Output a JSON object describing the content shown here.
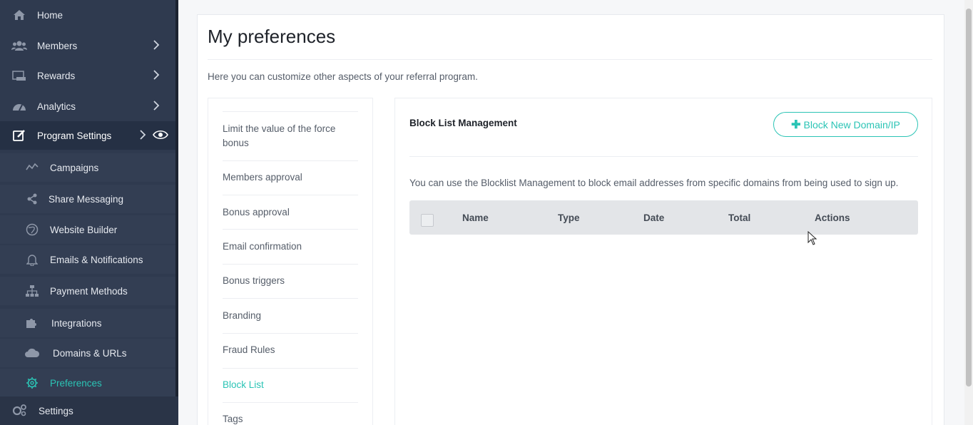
{
  "sidebar": {
    "items": [
      {
        "label": "Home",
        "icon": "home-icon"
      },
      {
        "label": "Members",
        "icon": "members-icon"
      },
      {
        "label": "Rewards",
        "icon": "rewards-icon"
      },
      {
        "label": "Analytics",
        "icon": "analytics-icon"
      },
      {
        "label": "Program Settings",
        "icon": "edit-icon"
      }
    ],
    "subitems": [
      {
        "label": "Campaigns",
        "icon": "campaigns-icon"
      },
      {
        "label": "Share Messaging",
        "icon": "share-icon"
      },
      {
        "label": "Website Builder",
        "icon": "globe-icon"
      },
      {
        "label": "Emails & Notifications",
        "icon": "bell-icon"
      },
      {
        "label": "Payment Methods",
        "icon": "sitemap-icon"
      },
      {
        "label": "Integrations",
        "icon": "puzzle-icon"
      },
      {
        "label": "Domains & URLs",
        "icon": "cloud-icon"
      },
      {
        "label": "Preferences",
        "icon": "gear-icon"
      }
    ],
    "bottom": {
      "label": "Settings",
      "icon": "cogs-icon"
    }
  },
  "page": {
    "title": "My preferences",
    "intro": "Here you can customize other aspects of your referral program."
  },
  "subnav": {
    "items": [
      "Limit the value of the force bonus",
      "Members approval",
      "Bonus approval",
      "Email confirmation",
      "Bonus triggers",
      "Branding",
      "Fraud Rules",
      "Block List",
      "Tags"
    ],
    "current": "Block List"
  },
  "panel": {
    "title": "Block List Management",
    "button_label": "Block New Domain/IP",
    "description": "You can use the Blocklist Management to block email addresses from specific domains from being used to sign up.",
    "columns": [
      "Name",
      "Type",
      "Date",
      "Total",
      "Actions"
    ]
  },
  "colors": {
    "accent": "#2bc4b5",
    "sidebar_bg": "#2f3a4f"
  }
}
